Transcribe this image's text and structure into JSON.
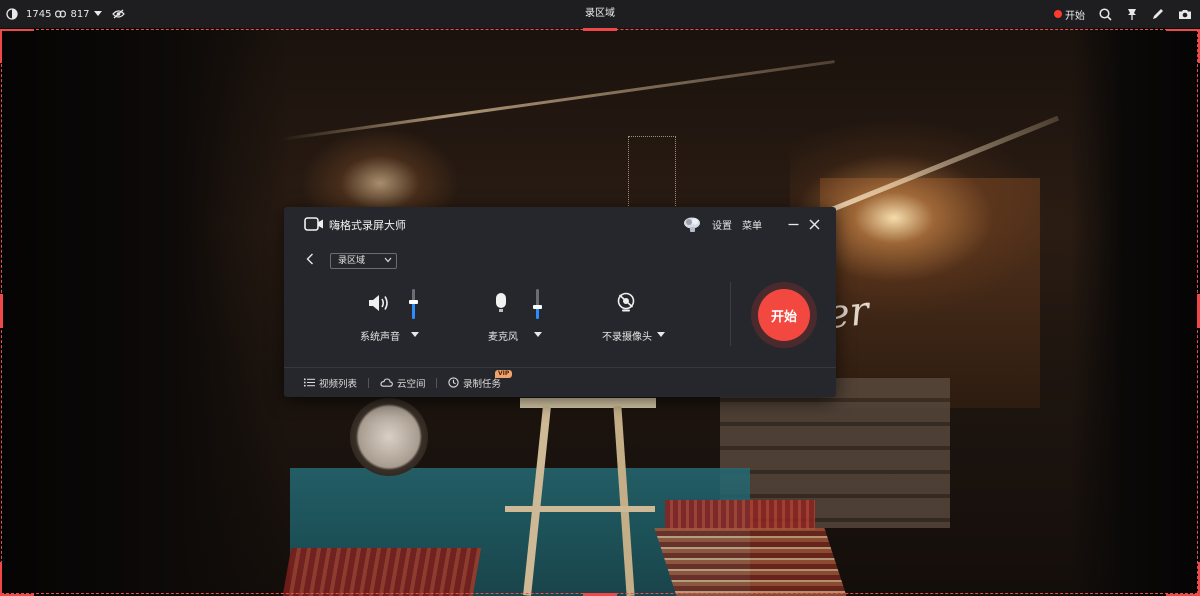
{
  "topbar": {
    "width_value": "1745",
    "height_value": "817",
    "center_title": "录区域",
    "start_label": "开始",
    "icons": [
      "contrast-icon",
      "link-icon",
      "chevron-down-icon",
      "eye-off-icon",
      "record-dot-icon",
      "search-magnify-icon",
      "pin-icon",
      "pen-icon",
      "camera-icon"
    ]
  },
  "panel": {
    "app_title": "嗨格式录屏大师",
    "settings_label": "设置",
    "menu_label": "菜单",
    "mode_dropdown": "录区域",
    "system_audio": {
      "label": "系统声音",
      "level": 0.55
    },
    "microphone": {
      "label": "麦克风",
      "level": 0.4
    },
    "camera": {
      "label": "不录摄像头"
    },
    "start_button": "开始",
    "footer": {
      "video_list": "视频列表",
      "cloud_space": "云空间",
      "record_task": "录制任务",
      "vip_badge": "VIP"
    },
    "colors": {
      "accent_blue": "#2b8cff",
      "start_red": "#f2483f",
      "panel_bg": "#26272c"
    }
  },
  "background": {
    "neon_text": "er"
  }
}
